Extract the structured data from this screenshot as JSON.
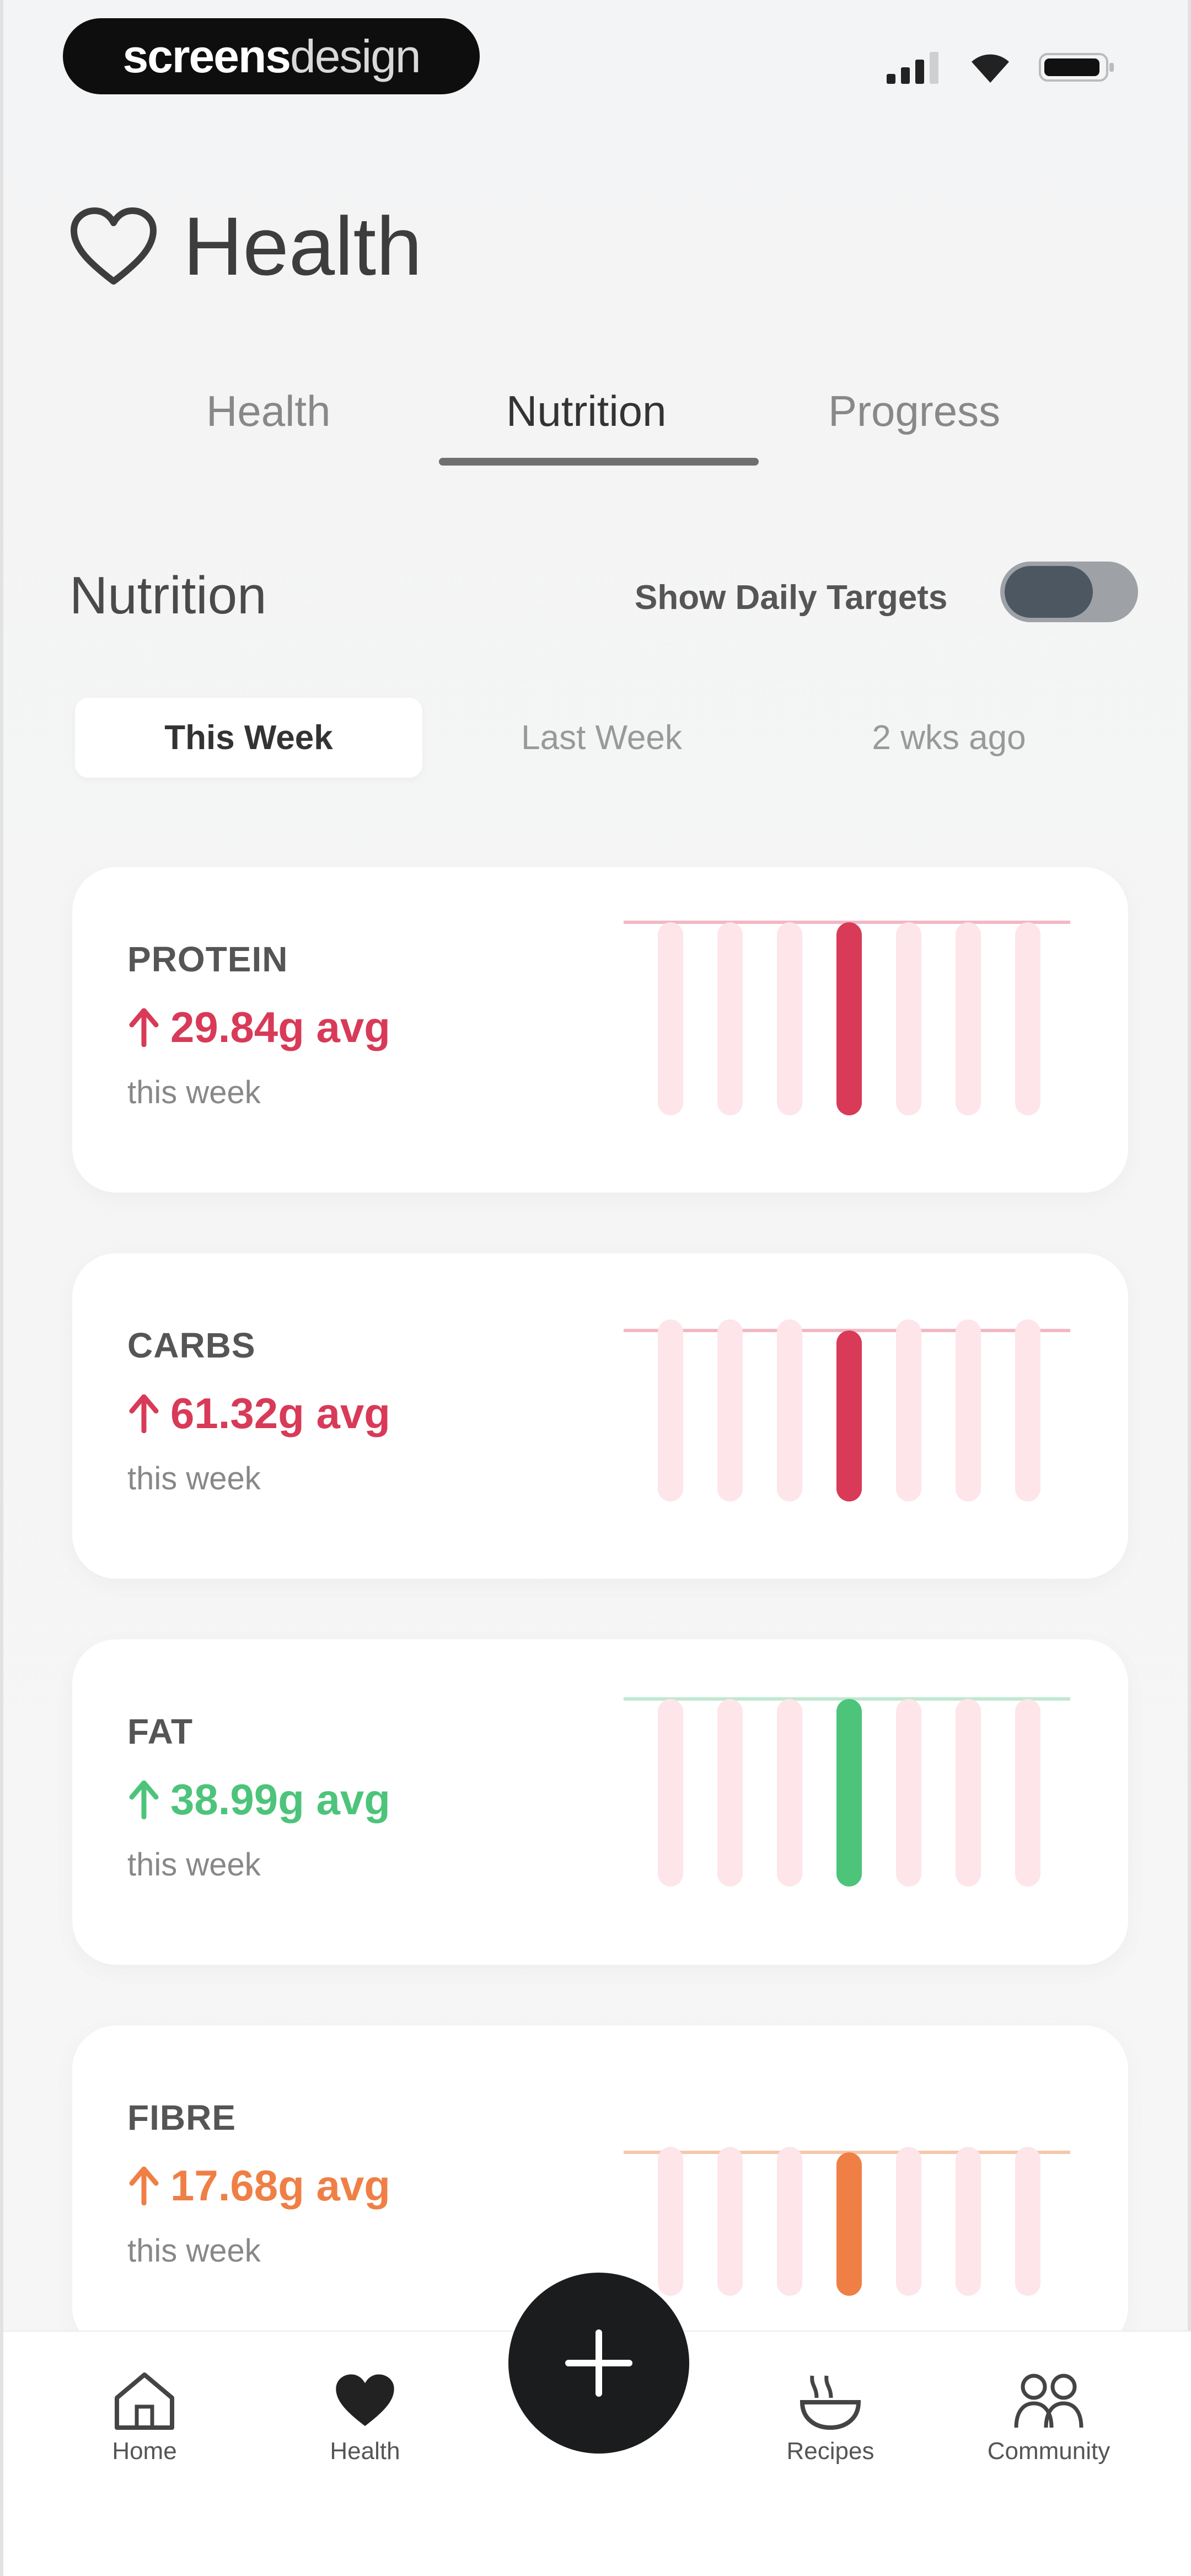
{
  "status_bar": {
    "brand_bold": "screens",
    "brand_light": "design"
  },
  "header": {
    "title": "Health"
  },
  "tabs": [
    {
      "label": "Health"
    },
    {
      "label": "Nutrition"
    },
    {
      "label": "Progress"
    }
  ],
  "nutrition": {
    "title": "Nutrition",
    "targets_label": "Show Daily Targets"
  },
  "periods": [
    {
      "label": "This Week"
    },
    {
      "label": "Last Week"
    },
    {
      "label": "2 wks ago"
    }
  ],
  "cards": [
    {
      "label": "PROTEIN",
      "avg": "29.84g avg",
      "sub": "this week",
      "color": "#d83a57"
    },
    {
      "label": "CARBS",
      "avg": "61.32g avg",
      "sub": "this week",
      "color": "#d83a57"
    },
    {
      "label": "FAT",
      "avg": "38.99g avg",
      "sub": "this week",
      "color": "#4cc47a"
    },
    {
      "label": "FIBRE",
      "avg": "17.68g avg",
      "sub": "this week",
      "color": "#ef7f45"
    }
  ],
  "nav": {
    "home": "Home",
    "health": "Health",
    "recipes": "Recipes",
    "community": "Community"
  }
}
